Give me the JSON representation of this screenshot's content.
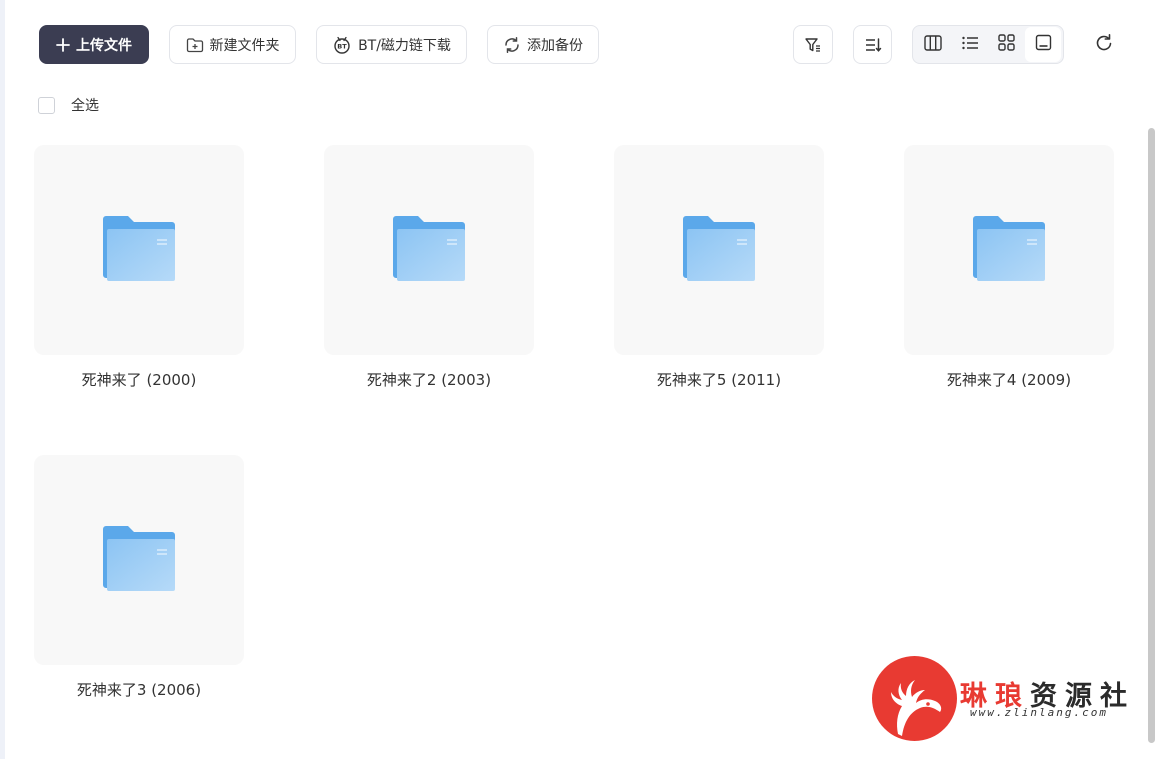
{
  "toolbar": {
    "upload_label": "上传文件",
    "new_folder_label": "新建文件夹",
    "bt_label": "BT/磁力链下载",
    "backup_label": "添加备份"
  },
  "select_all_label": "全选",
  "files": [
    {
      "name": "死神来了 (2000)"
    },
    {
      "name": "死神来了2 (2003)"
    },
    {
      "name": "死神来了5 (2011)"
    },
    {
      "name": "死神来了4 (2009)"
    },
    {
      "name": "死神来了3 (2006)"
    }
  ],
  "watermark": {
    "title_part1": "琳琅",
    "title_part2": "资源社",
    "url": "www.zlinlang.com"
  },
  "icons": {
    "upload": "plus-icon",
    "new_folder": "folder-plus-icon",
    "bt": "bt-icon",
    "backup": "sync-icon",
    "filter": "filter-icon",
    "sort": "sort-icon",
    "view_columns": "columns-icon",
    "view_list": "list-icon",
    "view_grid": "grid-icon",
    "view_thumb": "thumbnail-icon",
    "refresh": "refresh-icon",
    "folder": "folder-icon"
  },
  "colors": {
    "primary_button": "#3b3d52",
    "folder": "#8cc4f3",
    "tile_bg": "#f8f8f8",
    "watermark_red": "#e83a32"
  }
}
